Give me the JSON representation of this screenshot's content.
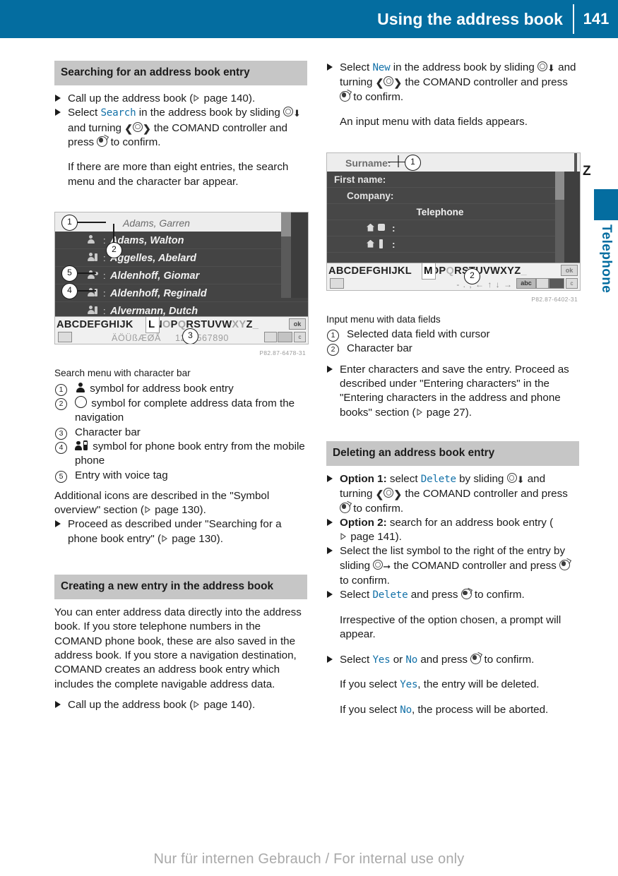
{
  "header": {
    "title": "Using the address book",
    "page_number": "141"
  },
  "sidebar": {
    "tab_label": "Telephone",
    "marker": "Z"
  },
  "watermark": "Nur für internen Gebrauch / For internal use only",
  "left_column": {
    "section1": {
      "heading": "Searching for an address book entry",
      "bullet1_a": "Call up the address book (",
      "bullet1_page": "page 140",
      "bullet1_b": ").",
      "bullet2_a": "Select ",
      "bullet2_menu": "Search",
      "bullet2_b": " in the address book by slid­ing ",
      "bullet2_c": " and turning ",
      "bullet2_d": " the COMAND controller and press ",
      "bullet2_e": " to confirm.",
      "bullet2_cont": "If there are more than eight entries, the search menu and the character bar appear."
    },
    "figure1": {
      "code": "P82.87-6478-31",
      "caption": "Search menu with character bar",
      "rows": [
        "Adams, Garren",
        "Adams, Walton",
        "Aggelles, Abelard",
        "Aldenhoff, Giomar",
        "Aldenhoff, Reginald",
        "Alvermann, Dutch"
      ],
      "alpha_active": "ABCDEFGHIJKL",
      "alpha_highlight": "L",
      "alpha_rest": "MNOPQRSTUVWXYZ",
      "alpha_dim": "_",
      "ok_label": "ok",
      "accents": "ÄÖÜßÆØÅ",
      "digits": "1234567890",
      "clear_label": "c",
      "callouts": [
        "1",
        "2",
        "3",
        "4",
        "5"
      ]
    },
    "legend1": [
      {
        "num": "1",
        "icon": "person-icon",
        "text": "symbol for address book entry"
      },
      {
        "num": "2",
        "icon": "compass-icon",
        "text": "symbol for complete address data from the navigation"
      },
      {
        "num": "3",
        "icon": "",
        "text": "Character bar"
      },
      {
        "num": "4",
        "icon": "person-phone-icon",
        "text": "symbol for phone book entry from the mobile phone"
      },
      {
        "num": "5",
        "icon": "",
        "text": "Entry with voice tag"
      }
    ],
    "after_legend": {
      "para_a": "Additional icons are described in the \"Symbol overview\" section (",
      "para_page": "page 130",
      "para_b": ").",
      "bullet_a": "Proceed as described under \"Searching for a phone book entry\" (",
      "bullet_page": "page 130",
      "bullet_b": ")."
    },
    "section2": {
      "heading": "Creating a new entry in the address book",
      "para": "You can enter address data directly into the address book. If you store telephone num­bers in the COMAND phone book, these are also saved in the address book. If you store a navigation destination, COMAND creates an address book entry which includes the com­plete navigable address data.",
      "bullet_a": "Call up the address book (",
      "bullet_page": "page 140",
      "bullet_b": ")."
    }
  },
  "right_column": {
    "top_bullet": {
      "a": "Select ",
      "menu": "New",
      "b": " in the address book by sliding ",
      "c": " and turning ",
      "d": " the COMAND con­troller and press ",
      "e": " to confirm.",
      "cont": "An input menu with data fields appears."
    },
    "figure2": {
      "code": "P82.87-6402-31",
      "caption": "Input menu with data fields",
      "fields": [
        "Surname:",
        "First name:",
        "Company:"
      ],
      "section_label": "Telephone",
      "alpha": "ABCDEFGHIJKLMNOPQRSTUVWXYZ",
      "alpha_highlight": "M",
      "ok_label": "ok",
      "abc_label": "abc",
      "clear_label": "c",
      "callouts": [
        "1",
        "2"
      ]
    },
    "legend2": [
      {
        "num": "1",
        "text": "Selected data field with cursor"
      },
      {
        "num": "2",
        "text": "Character bar"
      }
    ],
    "enter_bullet": {
      "a": "Enter characters and save the entry. Pro­ceed as described under \"Entering charac­ters\" in the \"Entering characters in the address and phone books\" section (",
      "page": "page 27",
      "b": ")."
    },
    "section_delete": {
      "heading": "Deleting an address book entry",
      "b1_opt": "Option 1:",
      "b1_a": " select ",
      "b1_menu": "Delete",
      "b1_b": " by sliding ",
      "b1_c": " and turning ",
      "b1_d": " the COMAND controller and press ",
      "b1_e": " to confirm.",
      "b2_opt": "Option 2:",
      "b2_a": " search for an address book entry (",
      "b2_page": "page 141",
      "b2_b": ").",
      "b3_a": "Select the list symbol to the right of the entry by sliding ",
      "b3_b": " the COMAND control­ler and press ",
      "b3_c": " to confirm.",
      "b4_a": "Select ",
      "b4_menu": "Delete",
      "b4_b": " and press ",
      "b4_c": " to confirm.",
      "b4_cont": "Irrespective of the option chosen, a prompt will appear.",
      "b5_a": "Select ",
      "b5_menu1": "Yes",
      "b5_b": " or ",
      "b5_menu2": "No",
      "b5_c": " and press ",
      "b5_d": " to confirm.",
      "b5_cont1_a": "If you select ",
      "b5_cont1_menu": "Yes",
      "b5_cont1_b": ", the entry will be deleted.",
      "b5_cont2_a": "If you select ",
      "b5_cont2_menu": "No",
      "b5_cont2_b": ", the process will be aborted."
    }
  },
  "colors": {
    "brand_blue": "#046da0",
    "menu_text": "#1371a8",
    "section_bar": "#c6c6c6"
  }
}
